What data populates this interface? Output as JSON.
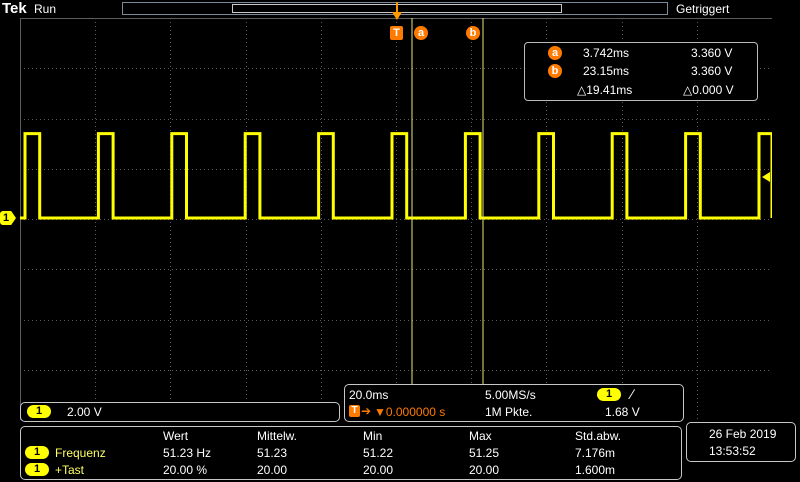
{
  "header": {
    "brand": "Tek",
    "run_state": "Run",
    "trigger_state": "Getriggert"
  },
  "markers": {
    "trigger": "T",
    "cursor_a": "a",
    "cursor_b": "b",
    "channel": "1"
  },
  "cursors": {
    "a": {
      "label": "a",
      "time": "3.742ms",
      "value": "3.360 V"
    },
    "b": {
      "label": "b",
      "time": "23.15ms",
      "value": "3.360 V"
    },
    "delta_time": "△19.41ms",
    "delta_value": "△0.000 V"
  },
  "channel": {
    "number": "1",
    "scale": "2.00 V"
  },
  "horizontal": {
    "time_div": "20.0ms",
    "sample_rate": "5.00MS/s",
    "trigger_channel": "1",
    "trigger_slope": "∕",
    "trigger_icon": "T",
    "trigger_position": "▼0.000000 s",
    "record_length": "1M Pkte.",
    "trigger_level": "1.68 V"
  },
  "measurements": {
    "headers": [
      "Wert",
      "Mittelw.",
      "Min",
      "Max",
      "Std.abw."
    ],
    "rows": [
      {
        "channel": "1",
        "name": "Frequenz",
        "values": [
          "51.23 Hz",
          "51.23",
          "51.22",
          "51.25",
          "7.176m"
        ]
      },
      {
        "channel": "1",
        "name": "+Tast",
        "values": [
          "20.00 %",
          "20.00",
          "20.00",
          "20.00",
          "1.600m"
        ]
      }
    ]
  },
  "datetime": {
    "date": "26 Feb  2019",
    "time": "13:53:52"
  },
  "colors": {
    "trace": "#ffff00",
    "grid": "#5c5c5c",
    "cursor": "#ff7a00",
    "cursor_line": "#e6e67a"
  },
  "waveform": {
    "type": "square",
    "frequency_hz": 51.23,
    "duty_percent": 20.0,
    "high_v": 3.36,
    "low_v": 0.0,
    "time_div_ms": 20.0,
    "volts_div": 2.0
  }
}
